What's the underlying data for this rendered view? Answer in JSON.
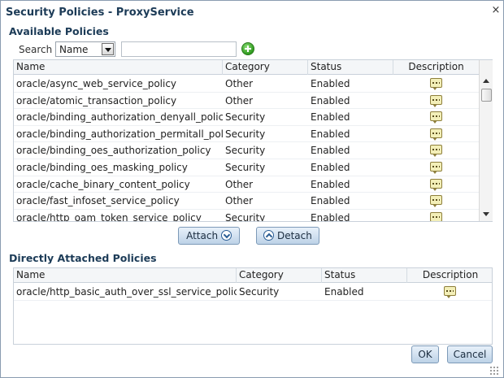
{
  "dialog": {
    "title": "Security Policies - ProxyService",
    "close_symbol": "×"
  },
  "available": {
    "section_title": "Available Policies",
    "search_label": "Search",
    "search_field_selected": "Name",
    "search_text": "",
    "go_icon": "add-circle-icon",
    "columns": [
      "Name",
      "Category",
      "Status",
      "Description"
    ],
    "rows": [
      {
        "name": "oracle/async_web_service_policy",
        "category": "Other",
        "status": "Enabled"
      },
      {
        "name": "oracle/atomic_transaction_policy",
        "category": "Other",
        "status": "Enabled"
      },
      {
        "name": "oracle/binding_authorization_denyall_policy",
        "category": "Security",
        "status": "Enabled"
      },
      {
        "name": "oracle/binding_authorization_permitall_policy",
        "category": "Security",
        "status": "Enabled"
      },
      {
        "name": "oracle/binding_oes_authorization_policy",
        "category": "Security",
        "status": "Enabled"
      },
      {
        "name": "oracle/binding_oes_masking_policy",
        "category": "Security",
        "status": "Enabled"
      },
      {
        "name": "oracle/cache_binary_content_policy",
        "category": "Other",
        "status": "Enabled"
      },
      {
        "name": "oracle/fast_infoset_service_policy",
        "category": "Other",
        "status": "Enabled"
      },
      {
        "name": "oracle/http_oam_token_service_policy",
        "category": "Security",
        "status": "Enabled"
      }
    ]
  },
  "actions": {
    "attach_label": "Attach",
    "detach_label": "Detach"
  },
  "attached": {
    "section_title": "Directly Attached Policies",
    "columns": [
      "Name",
      "Category",
      "Status",
      "Description"
    ],
    "rows": [
      {
        "name": "oracle/http_basic_auth_over_ssl_service_policy",
        "category": "Security",
        "status": "Enabled"
      }
    ]
  },
  "footer": {
    "ok_label": "OK",
    "cancel_label": "Cancel"
  },
  "colors": {
    "title_text": "#1c3b57",
    "button_gradient_top": "#e8f1fa",
    "button_gradient_bottom": "#bdd2e7",
    "button_border": "#7d9ab8"
  }
}
